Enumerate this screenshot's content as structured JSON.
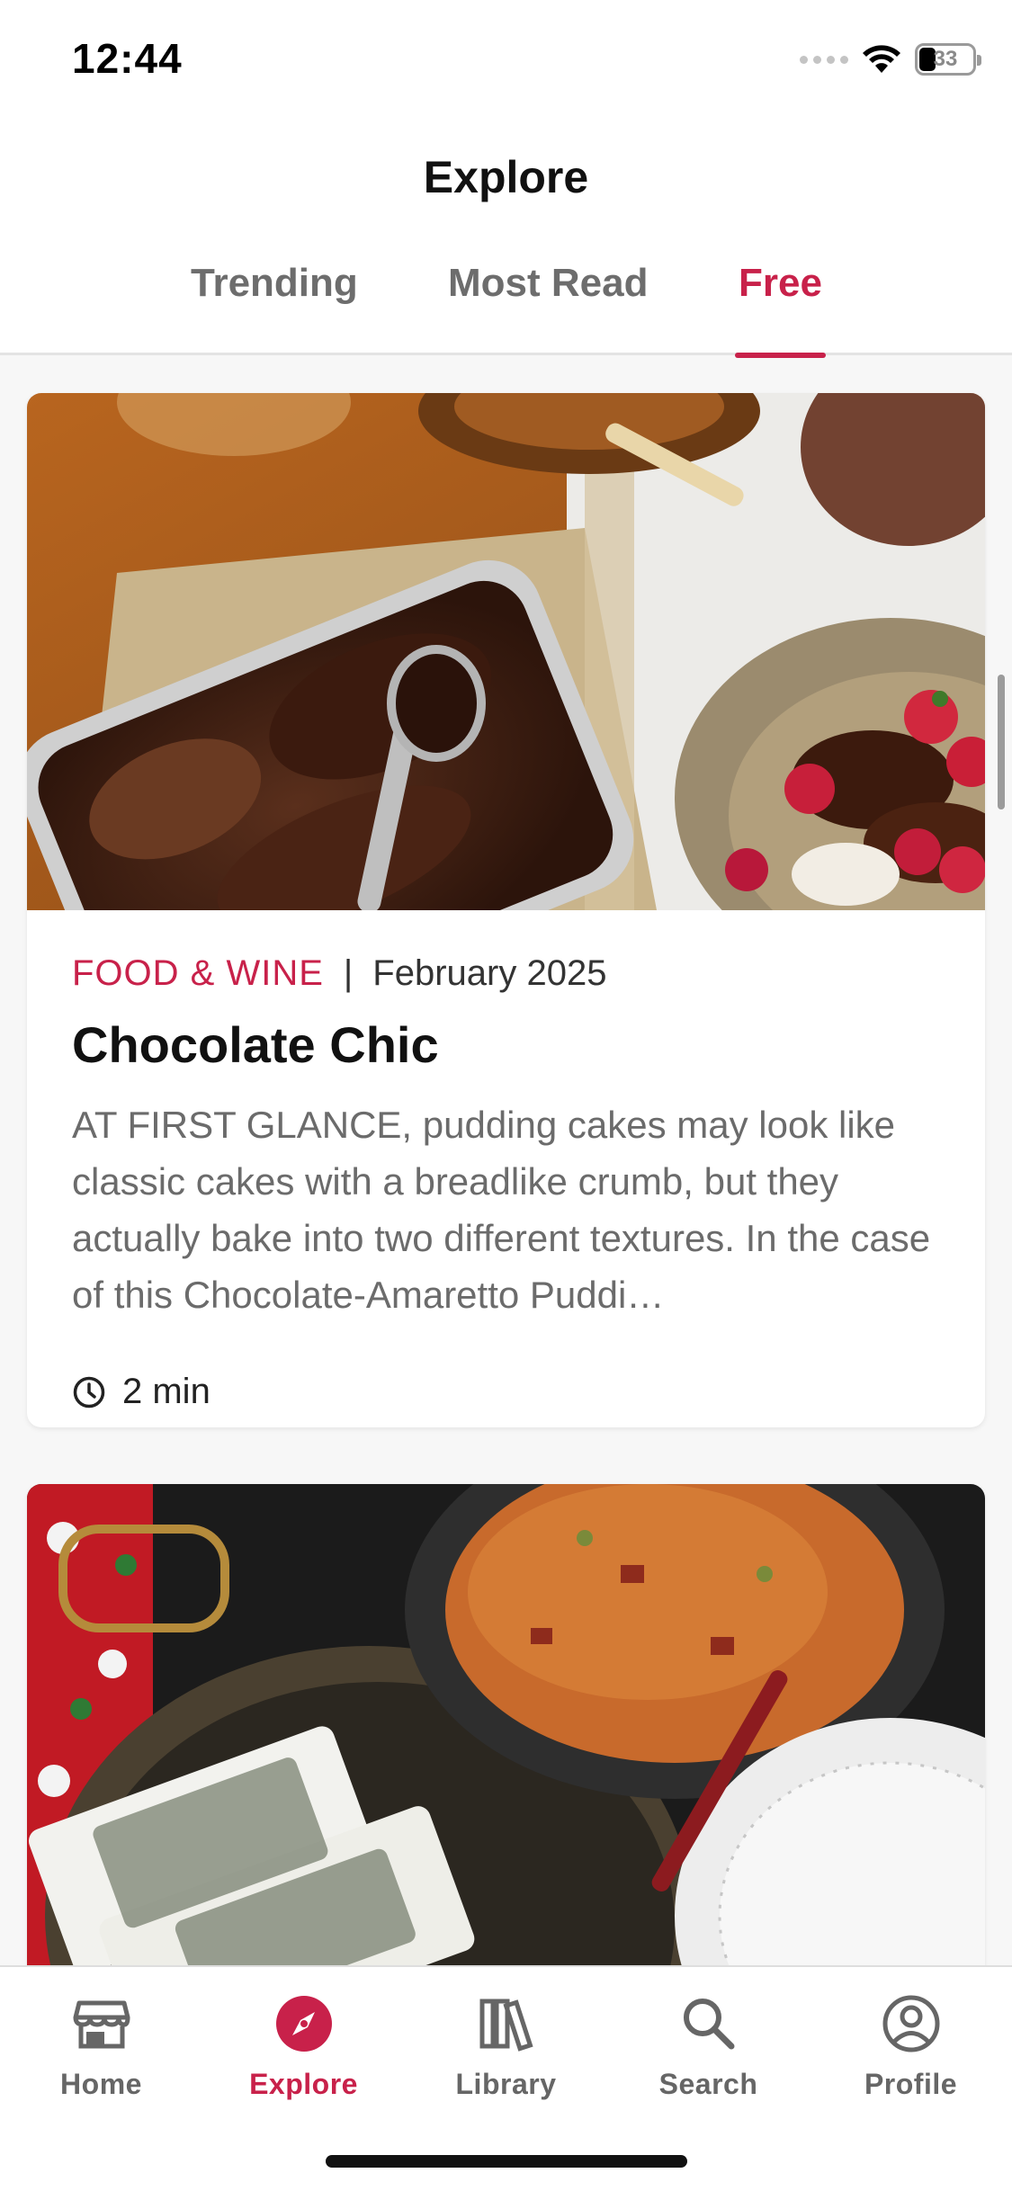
{
  "status_bar": {
    "time": "12:44",
    "battery_percent": "33",
    "icons": [
      "cellular-signal-icon",
      "wifi-icon",
      "battery-icon"
    ]
  },
  "header": {
    "title": "Explore",
    "tabs": [
      {
        "label": "Trending",
        "active": false
      },
      {
        "label": "Most Read",
        "active": false
      },
      {
        "label": "Free",
        "active": true
      }
    ]
  },
  "articles": [
    {
      "source": "FOOD & WINE",
      "separator": "|",
      "date": "February 2025",
      "title": "Chocolate Chic",
      "excerpt": "AT FIRST GLANCE, pudding cakes may look like classic cakes with a breadlike crumb, but they actually bake into two different textures. In the case of this Chocolate-Amaretto Puddi…",
      "read_time": "2 min",
      "image_icon": "chocolate-pudding-cake-photo"
    },
    {
      "image_icon": "rice-and-tamales-photo"
    }
  ],
  "bottom_nav": {
    "items": [
      {
        "label": "Home",
        "icon": "storefront-icon",
        "active": false
      },
      {
        "label": "Explore",
        "icon": "compass-icon",
        "active": true
      },
      {
        "label": "Library",
        "icon": "books-icon",
        "active": false
      },
      {
        "label": "Search",
        "icon": "search-icon",
        "active": false
      },
      {
        "label": "Profile",
        "icon": "profile-icon",
        "active": false
      }
    ]
  },
  "colors": {
    "accent": "#c8214a",
    "inactive_tab": "#6d6d6d",
    "excerpt_text": "#6b6b6b",
    "background": "#f7f7f7"
  }
}
